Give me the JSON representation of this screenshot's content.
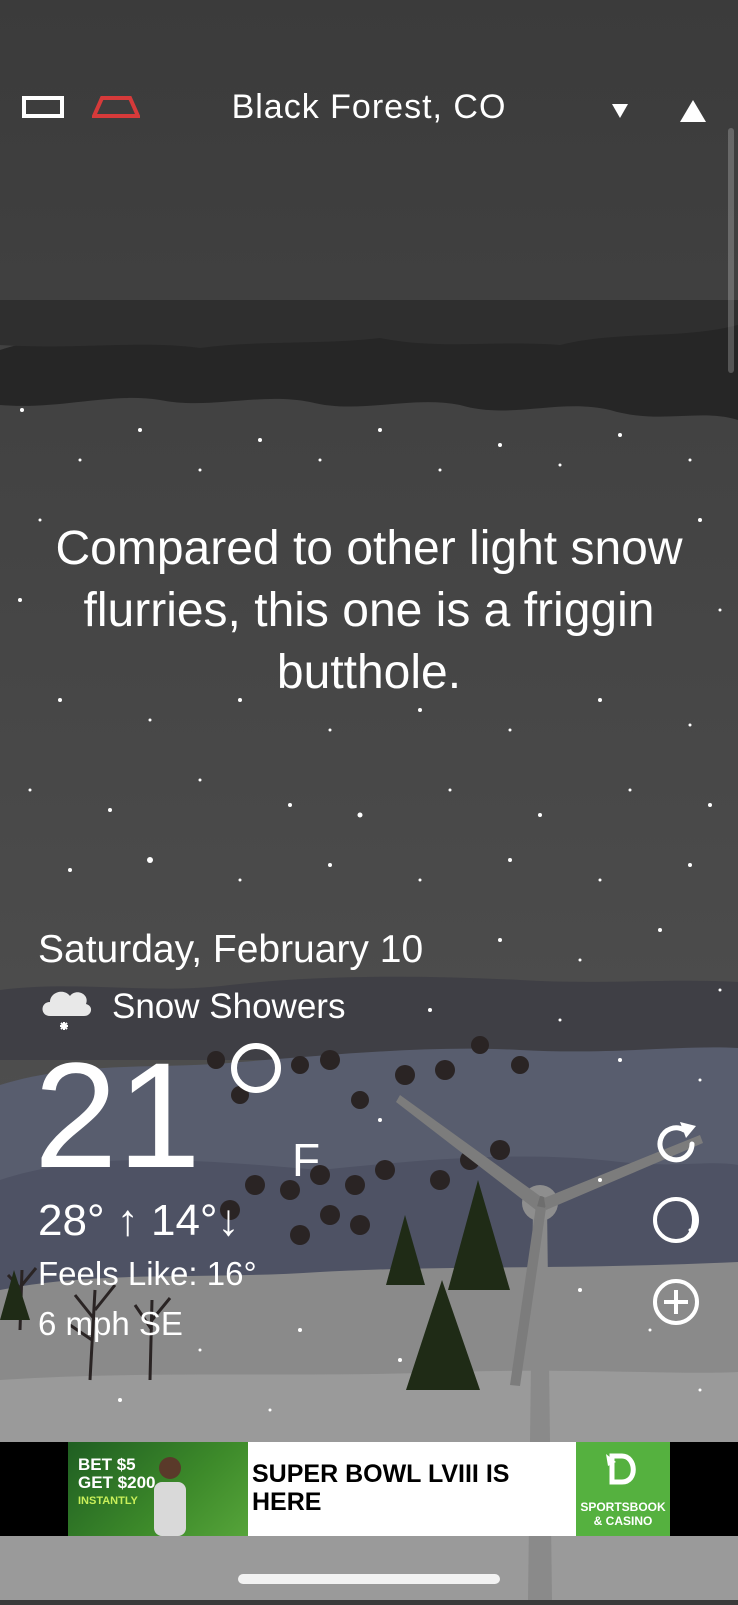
{
  "header": {
    "location": "Black Forest, CO",
    "icons": [
      "menu-icon",
      "alert-icon",
      "location-arrow-icon",
      "person-icon"
    ]
  },
  "main": {
    "quote": "Compared to other light snow flurries, this one is a friggin butthole.",
    "date": "Saturday, February 10",
    "condition": "Snow Showers",
    "condition_icon": "snow-cloud-icon",
    "temperature": "21",
    "temp_unit": "F",
    "hi_lo": "28° ↑ 14°↓",
    "feels_like": "Feels Like: 16°",
    "wind": "6 mph SE"
  },
  "side_actions": [
    "refresh-icon",
    "moon-icon",
    "add-icon"
  ],
  "ad": {
    "promo_line1": "BET $5",
    "promo_line2": "GET $200",
    "promo_line3": "INSTANTLY",
    "headline": "SUPER BOWL LVIII IS HERE",
    "logo_text": "SPORTSBOOK & CASINO"
  },
  "colors": {
    "sky": "#3a3a3a",
    "cloud": "#232323",
    "hill_blue": "#5b6070",
    "ground": "#8d8d8d",
    "tree_dark": "#1e2a14",
    "ad_green": "#55b13f"
  }
}
